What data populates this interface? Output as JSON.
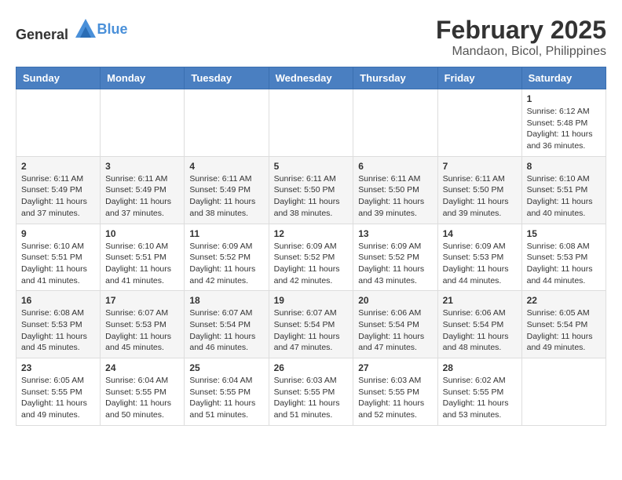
{
  "header": {
    "logo_general": "General",
    "logo_blue": "Blue",
    "main_title": "February 2025",
    "sub_title": "Mandaon, Bicol, Philippines"
  },
  "calendar": {
    "days_of_week": [
      "Sunday",
      "Monday",
      "Tuesday",
      "Wednesday",
      "Thursday",
      "Friday",
      "Saturday"
    ],
    "weeks": [
      [
        {
          "day": "",
          "info": ""
        },
        {
          "day": "",
          "info": ""
        },
        {
          "day": "",
          "info": ""
        },
        {
          "day": "",
          "info": ""
        },
        {
          "day": "",
          "info": ""
        },
        {
          "day": "",
          "info": ""
        },
        {
          "day": "1",
          "info": "Sunrise: 6:12 AM\nSunset: 5:48 PM\nDaylight: 11 hours and 36 minutes."
        }
      ],
      [
        {
          "day": "2",
          "info": "Sunrise: 6:11 AM\nSunset: 5:49 PM\nDaylight: 11 hours and 37 minutes."
        },
        {
          "day": "3",
          "info": "Sunrise: 6:11 AM\nSunset: 5:49 PM\nDaylight: 11 hours and 37 minutes."
        },
        {
          "day": "4",
          "info": "Sunrise: 6:11 AM\nSunset: 5:49 PM\nDaylight: 11 hours and 38 minutes."
        },
        {
          "day": "5",
          "info": "Sunrise: 6:11 AM\nSunset: 5:50 PM\nDaylight: 11 hours and 38 minutes."
        },
        {
          "day": "6",
          "info": "Sunrise: 6:11 AM\nSunset: 5:50 PM\nDaylight: 11 hours and 39 minutes."
        },
        {
          "day": "7",
          "info": "Sunrise: 6:11 AM\nSunset: 5:50 PM\nDaylight: 11 hours and 39 minutes."
        },
        {
          "day": "8",
          "info": "Sunrise: 6:10 AM\nSunset: 5:51 PM\nDaylight: 11 hours and 40 minutes."
        }
      ],
      [
        {
          "day": "9",
          "info": "Sunrise: 6:10 AM\nSunset: 5:51 PM\nDaylight: 11 hours and 41 minutes."
        },
        {
          "day": "10",
          "info": "Sunrise: 6:10 AM\nSunset: 5:51 PM\nDaylight: 11 hours and 41 minutes."
        },
        {
          "day": "11",
          "info": "Sunrise: 6:09 AM\nSunset: 5:52 PM\nDaylight: 11 hours and 42 minutes."
        },
        {
          "day": "12",
          "info": "Sunrise: 6:09 AM\nSunset: 5:52 PM\nDaylight: 11 hours and 42 minutes."
        },
        {
          "day": "13",
          "info": "Sunrise: 6:09 AM\nSunset: 5:52 PM\nDaylight: 11 hours and 43 minutes."
        },
        {
          "day": "14",
          "info": "Sunrise: 6:09 AM\nSunset: 5:53 PM\nDaylight: 11 hours and 44 minutes."
        },
        {
          "day": "15",
          "info": "Sunrise: 6:08 AM\nSunset: 5:53 PM\nDaylight: 11 hours and 44 minutes."
        }
      ],
      [
        {
          "day": "16",
          "info": "Sunrise: 6:08 AM\nSunset: 5:53 PM\nDaylight: 11 hours and 45 minutes."
        },
        {
          "day": "17",
          "info": "Sunrise: 6:07 AM\nSunset: 5:53 PM\nDaylight: 11 hours and 45 minutes."
        },
        {
          "day": "18",
          "info": "Sunrise: 6:07 AM\nSunset: 5:54 PM\nDaylight: 11 hours and 46 minutes."
        },
        {
          "day": "19",
          "info": "Sunrise: 6:07 AM\nSunset: 5:54 PM\nDaylight: 11 hours and 47 minutes."
        },
        {
          "day": "20",
          "info": "Sunrise: 6:06 AM\nSunset: 5:54 PM\nDaylight: 11 hours and 47 minutes."
        },
        {
          "day": "21",
          "info": "Sunrise: 6:06 AM\nSunset: 5:54 PM\nDaylight: 11 hours and 48 minutes."
        },
        {
          "day": "22",
          "info": "Sunrise: 6:05 AM\nSunset: 5:54 PM\nDaylight: 11 hours and 49 minutes."
        }
      ],
      [
        {
          "day": "23",
          "info": "Sunrise: 6:05 AM\nSunset: 5:55 PM\nDaylight: 11 hours and 49 minutes."
        },
        {
          "day": "24",
          "info": "Sunrise: 6:04 AM\nSunset: 5:55 PM\nDaylight: 11 hours and 50 minutes."
        },
        {
          "day": "25",
          "info": "Sunrise: 6:04 AM\nSunset: 5:55 PM\nDaylight: 11 hours and 51 minutes."
        },
        {
          "day": "26",
          "info": "Sunrise: 6:03 AM\nSunset: 5:55 PM\nDaylight: 11 hours and 51 minutes."
        },
        {
          "day": "27",
          "info": "Sunrise: 6:03 AM\nSunset: 5:55 PM\nDaylight: 11 hours and 52 minutes."
        },
        {
          "day": "28",
          "info": "Sunrise: 6:02 AM\nSunset: 5:55 PM\nDaylight: 11 hours and 53 minutes."
        },
        {
          "day": "",
          "info": ""
        }
      ]
    ]
  }
}
